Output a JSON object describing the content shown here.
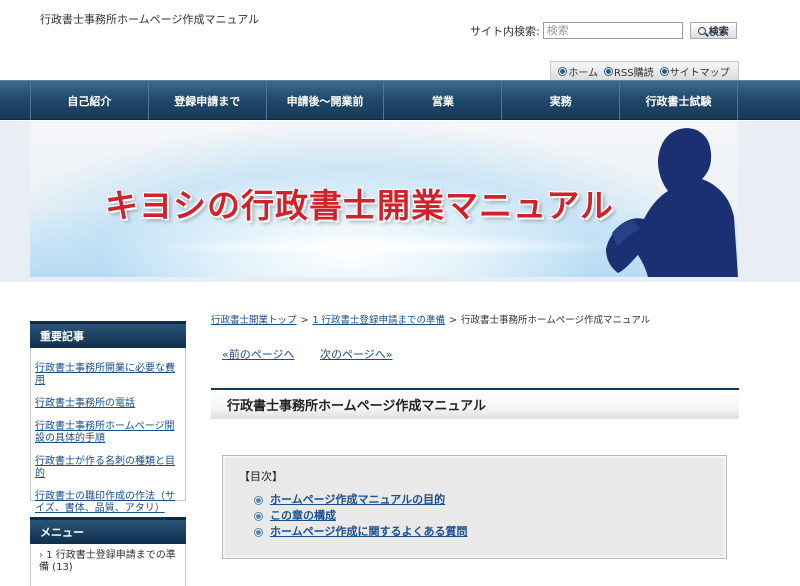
{
  "header": {
    "site_title": "行政書士事務所ホームページ作成マニュアル",
    "search_label": "サイト内検索:",
    "search_placeholder": "検索",
    "search_button": "検索"
  },
  "util_nav": [
    {
      "label": "ホーム"
    },
    {
      "label": "RSS購読"
    },
    {
      "label": "サイトマップ"
    }
  ],
  "main_nav": [
    {
      "label": "自己紹介"
    },
    {
      "label": "登録申請まで"
    },
    {
      "label": "申請後～開業前"
    },
    {
      "label": "営業"
    },
    {
      "label": "実務"
    },
    {
      "label": "行政書士試験"
    }
  ],
  "banner": {
    "title": "キヨシの行政書士開業マニュアル"
  },
  "sidebar": {
    "important_title": "重要記事",
    "important_items": [
      {
        "label": "行政書士事務所開業に必要な費用"
      },
      {
        "label": "行政書士事務所の電話"
      },
      {
        "label": "行政書士事務所ホームページ開設の具体的手順"
      },
      {
        "label": "行政書士が作る名刺の種類と目的"
      },
      {
        "label": "行政書士の職印作成の作法（サイズ、書体、品質、アタリ）"
      }
    ],
    "menu_title": "メニュー",
    "menu_items": [
      {
        "label": "1 行政書士登録申請までの準備 (13)"
      }
    ]
  },
  "breadcrumb": {
    "items": [
      {
        "label": "行政書士開業トップ"
      },
      {
        "label": "1 行政書士登録申請までの準備"
      }
    ],
    "current": "行政書士事務所ホームページ作成マニュアル",
    "separator": ">"
  },
  "pager": {
    "prev": "«前のページへ",
    "next": "次のページへ»"
  },
  "content": {
    "heading": "行政書士事務所ホームページ作成マニュアル",
    "toc_title": "【目次】",
    "toc_items": [
      {
        "label": "ホームページ作成マニュアルの目的"
      },
      {
        "label": "この章の構成"
      },
      {
        "label": "ホームページ作成に関するよくある質問"
      }
    ]
  },
  "colors": {
    "nav_bg": "#204868",
    "link": "#1b4f8a",
    "banner_title": "#d0222a"
  }
}
